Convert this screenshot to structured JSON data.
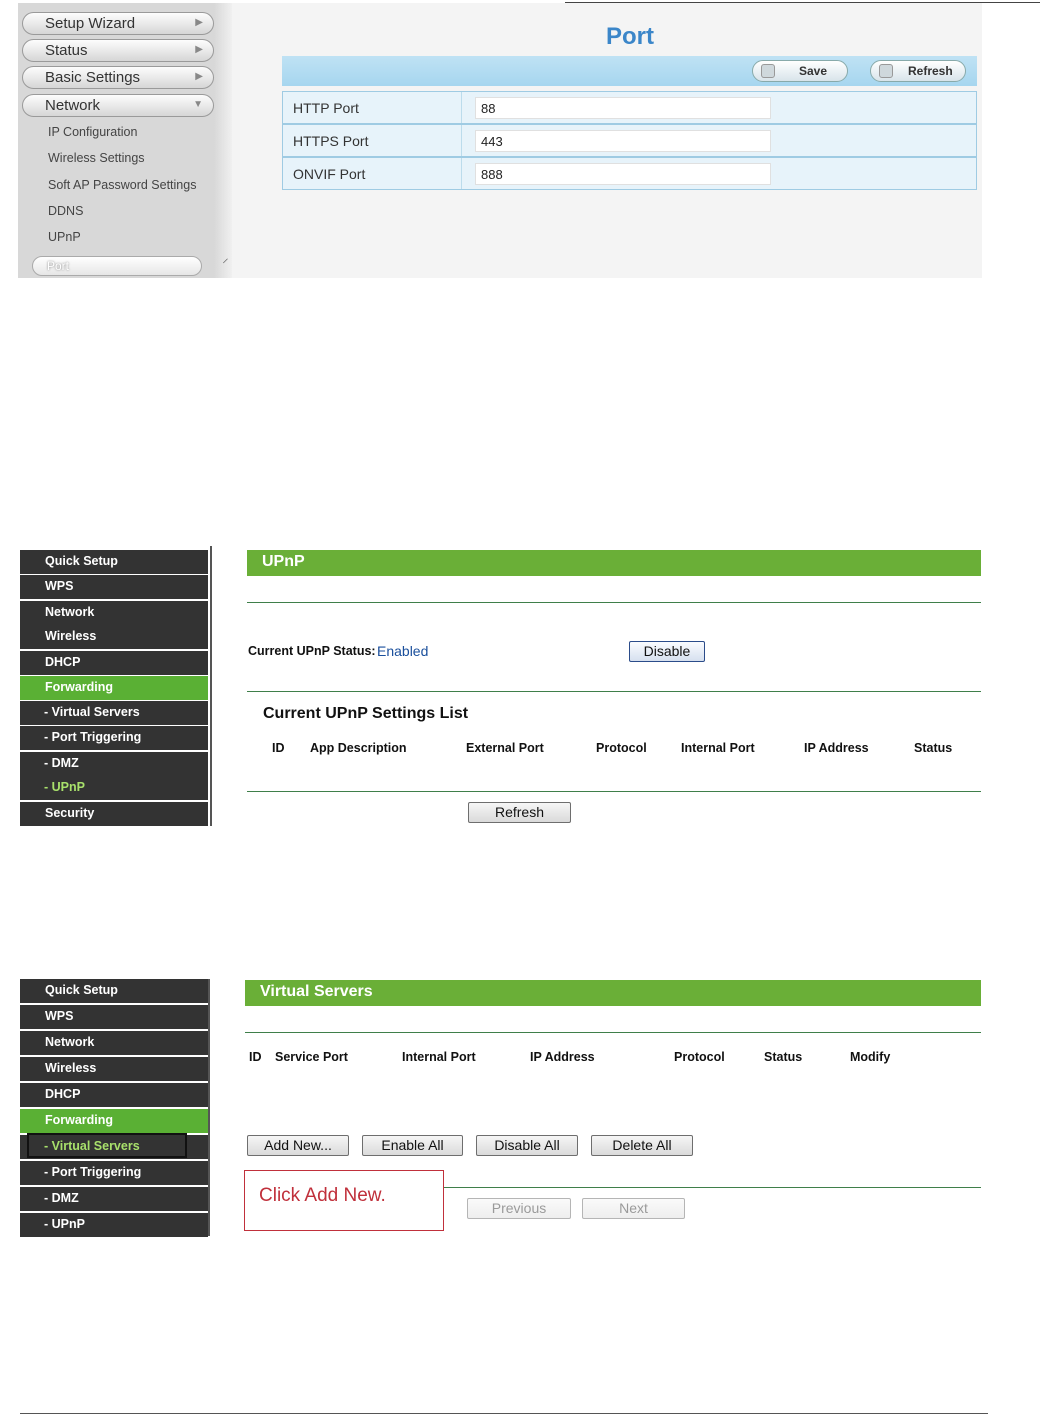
{
  "camera": {
    "sidebar": {
      "menus": [
        "Setup Wizard",
        "Status",
        "Basic Settings",
        "Network"
      ],
      "network_items": [
        "IP Configuration",
        "Wireless Settings",
        "Soft AP Password Settings",
        "DDNS",
        "UPnP",
        "Port"
      ]
    },
    "title": "Port",
    "toolbar": {
      "save_label": "Save",
      "refresh_label": "Refresh"
    },
    "fields": [
      {
        "label": "HTTP Port",
        "value": "88"
      },
      {
        "label": "HTTPS Port",
        "value": "443"
      },
      {
        "label": "ONVIF Port",
        "value": "888"
      }
    ]
  },
  "upnp_page": {
    "sidebar": [
      "Quick Setup",
      "WPS",
      "Network",
      "Wireless",
      "DHCP",
      "Forwarding",
      "- Virtual Servers",
      "- Port Triggering",
      "- DMZ",
      "- UPnP",
      "Security"
    ],
    "active_item": "Forwarding",
    "selected_subitem": "- UPnP",
    "title": "UPnP",
    "status_label": "Current UPnP Status:",
    "status_value": "Enabled",
    "disable_button": "Disable",
    "list_title": "Current UPnP Settings List",
    "columns": [
      "ID",
      "App Description",
      "External Port",
      "Protocol",
      "Internal Port",
      "IP Address",
      "Status"
    ],
    "refresh_button": "Refresh",
    "status_color": "#1a4f9c"
  },
  "virtual_servers_page": {
    "sidebar": [
      "Quick Setup",
      "WPS",
      "Network",
      "Wireless",
      "DHCP",
      "Forwarding",
      "- Virtual Servers",
      "- Port Triggering",
      "- DMZ",
      "- UPnP"
    ],
    "active_item": "Forwarding",
    "selected_subitem": "- Virtual Servers",
    "title": "Virtual Servers",
    "columns": [
      "ID",
      "Service Port",
      "Internal Port",
      "IP Address",
      "Protocol",
      "Status",
      "Modify"
    ],
    "buttons": {
      "add_new": "Add New...",
      "enable_all": "Enable All",
      "disable_all": "Disable All",
      "delete_all": "Delete All",
      "previous": "Previous",
      "next": "Next"
    },
    "annotation": "Click Add New."
  },
  "colors": {
    "router_green": "#6aaf37",
    "router_menu_dark": "#333333",
    "camera_title_blue": "#3b86c9",
    "annotation_red": "#c0303b"
  }
}
